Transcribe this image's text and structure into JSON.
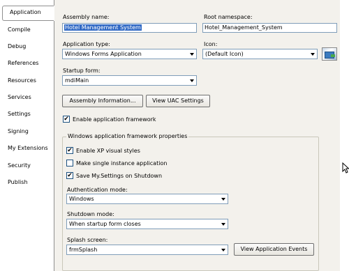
{
  "tabs": [
    "Application",
    "Compile",
    "Debug",
    "References",
    "Resources",
    "Services",
    "Settings",
    "Signing",
    "My Extensions",
    "Security",
    "Publish"
  ],
  "active_tab": "Application",
  "assembly_name": {
    "label": "Assembly name:",
    "value": "Hotel Management System"
  },
  "root_namespace": {
    "label": "Root namespace:",
    "value": "Hotel_Management_System"
  },
  "application_type": {
    "label": "Application type:",
    "value": "Windows Forms Application"
  },
  "icon": {
    "label": "Icon:",
    "value": "(Default Icon)"
  },
  "startup_form": {
    "label": "Startup form:",
    "value": "mdiMain"
  },
  "buttons": {
    "assembly_info": "Assembly Information...",
    "uac_settings": "View UAC Settings"
  },
  "enable_framework": {
    "label": "Enable application framework",
    "checked": true
  },
  "framework_group": {
    "title": "Windows application framework properties",
    "xp_styles": {
      "label": "Enable XP visual styles",
      "checked": true
    },
    "single_instance": {
      "label": "Make single instance application",
      "checked": false
    },
    "save_settings": {
      "label": "Save My.Settings on Shutdown",
      "checked": true
    },
    "auth_mode": {
      "label": "Authentication mode:",
      "value": "Windows"
    },
    "shutdown_mode": {
      "label": "Shutdown mode:",
      "value": "When startup form closes"
    },
    "splash_screen": {
      "label": "Splash screen:",
      "value": "frmSplash"
    },
    "view_events": "View Application Events"
  },
  "colors": {
    "selection": "#316ac5",
    "panel": "#f3f1ec",
    "field_border": "#7f9db9"
  },
  "icons": [
    "checkbox-checked",
    "checkbox-unchecked",
    "dropdown-arrow",
    "default-icon-preview",
    "mouse-cursor-arrow"
  ]
}
